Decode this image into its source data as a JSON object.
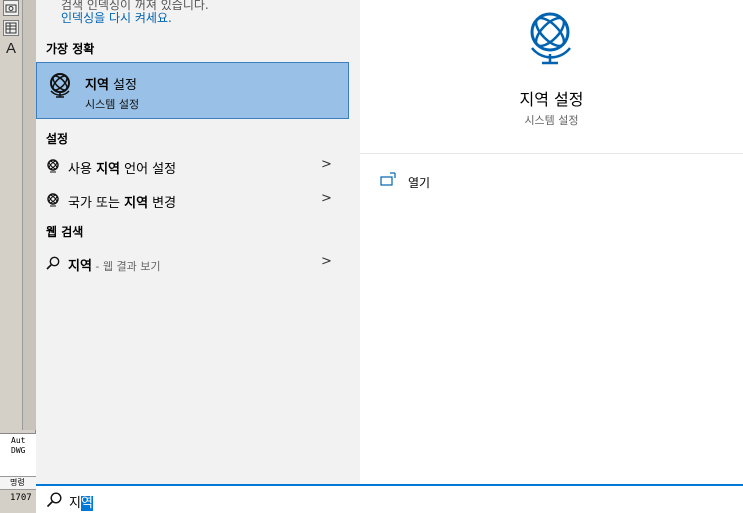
{
  "background_app": {
    "tool_text": "A",
    "cmd_lines": [
      "Aut",
      "DWG"
    ],
    "cmd_prompt": "명령",
    "coords": "1707"
  },
  "results": {
    "notice_text": "검색 인덱싱이 꺼져 있습니다.",
    "notice_link": "인덱싱을 다시 켜세요.",
    "best_match_header": "가장 정확",
    "best_match": {
      "title_bold": "지역",
      "title_rest": " 설정",
      "subtitle": "시스템 설정",
      "icon": "globe-icon"
    },
    "settings_header": "설정",
    "settings_items": [
      {
        "pre": "사용 ",
        "bold": "지역",
        "post": " 언어 설정",
        "icon": "globe-icon"
      },
      {
        "pre": "국가 또는 ",
        "bold": "지역",
        "post": " 변경",
        "icon": "globe-icon"
      }
    ],
    "web_header": "웹 검색",
    "web_item": {
      "bold": "지역",
      "post": " - 웹 결과 보기",
      "icon": "search-icon"
    },
    "chevron": ">"
  },
  "detail": {
    "title": "지역 설정",
    "subtitle": "시스템 설정",
    "open_label": "열기",
    "icon": "globe-icon"
  },
  "search": {
    "query_plain": "지",
    "query_selected": "역",
    "icon": "search-icon"
  },
  "colors": {
    "accent": "#0078d7",
    "selected_bg": "#99c0e6",
    "selected_border": "#3c7fbf"
  }
}
